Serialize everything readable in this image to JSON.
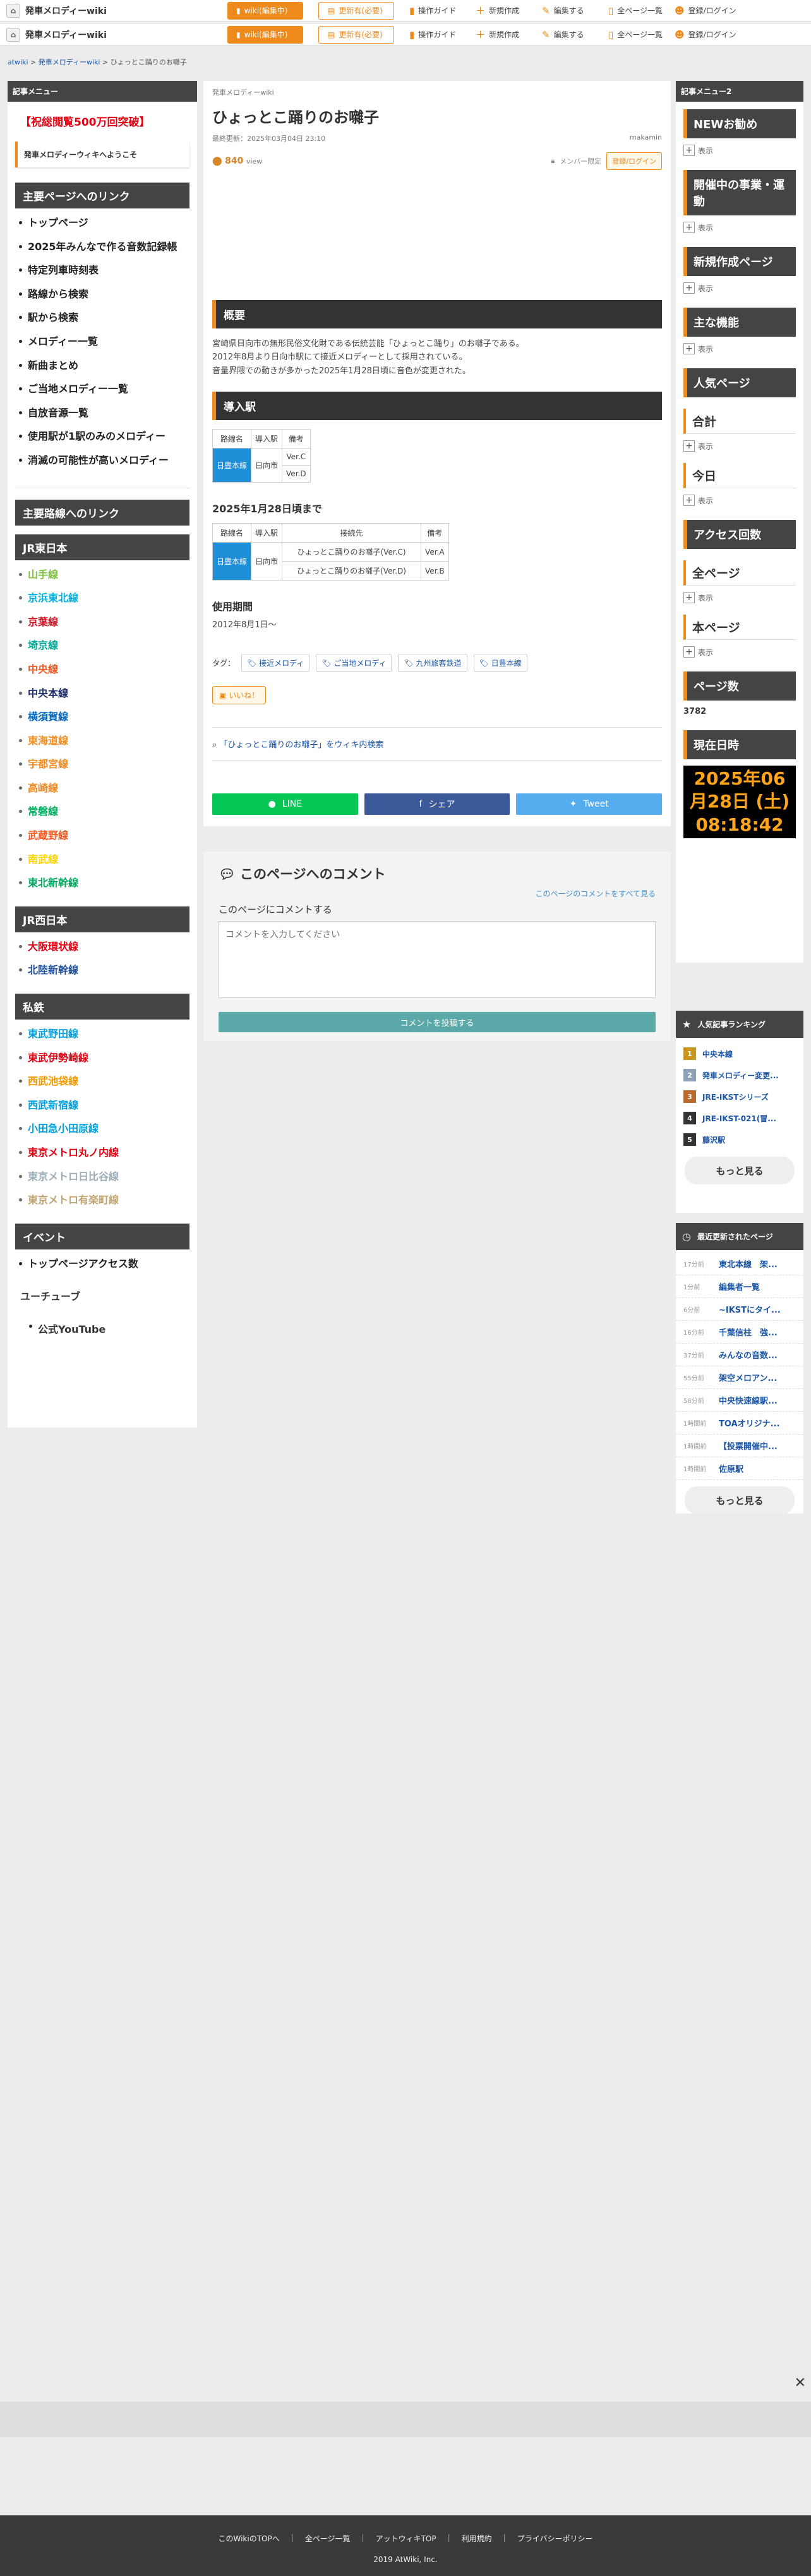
{
  "header": {
    "site_name": "発車メロディーwiki",
    "wiki_edit": "wiki(編集中)",
    "updated": "更新有(必要)",
    "links": [
      "操作ガイド",
      "新規作成",
      "編集する",
      "全ページ一覧",
      "登録/ログイン"
    ]
  },
  "breadcrumb": [
    "atwiki",
    "発車メロディーwiki",
    "ひょっとこ踊りのお囃子"
  ],
  "left": {
    "menu_title": "記事メニュー",
    "pv_text": "【祝総閲覧500万回突破】",
    "welcome": "発車メロディーウィキへようこそ",
    "main_links_head": "主要ページへのリンク",
    "main_links": [
      "トップページ",
      "2025年みんなで作る音数記録帳",
      "特定列車時刻表",
      "路線から検索",
      "駅から検索",
      "メロディー一覧",
      "新曲まとめ",
      "ご当地メロディー一覧",
      "自放音源一覧",
      "使用駅が1駅のみのメロディー",
      "消滅の可能性が高いメロディー"
    ],
    "routes_head": "主要路線へのリンク",
    "jr_east_head": "JR東日本",
    "jr_east": [
      {
        "name": "山手線",
        "color": "#80c241"
      },
      {
        "name": "京浜東北線",
        "color": "#00b2e5"
      },
      {
        "name": "京葉線",
        "color": "#d01827"
      },
      {
        "name": "埼京線",
        "color": "#00ac9a"
      },
      {
        "name": "中央線",
        "color": "#f15a22"
      },
      {
        "name": "中央本線",
        "color": "#1a2c6e"
      },
      {
        "name": "横須賀線",
        "color": "#0067c0"
      },
      {
        "name": "東海道線",
        "color": "#f68b1e"
      },
      {
        "name": "宇都宮線",
        "color": "#f68b1e"
      },
      {
        "name": "高崎線",
        "color": "#f68b1e"
      },
      {
        "name": "常磐線",
        "color": "#00b261"
      },
      {
        "name": "武蔵野線",
        "color": "#f15a22"
      },
      {
        "name": "南武線",
        "color": "#ffd400"
      },
      {
        "name": "東北新幹線",
        "color": "#00a862"
      }
    ],
    "jr_west_head": "JR西日本",
    "jr_west": [
      {
        "name": "大阪環状線",
        "color": "#e60012"
      },
      {
        "name": "北陸新幹線",
        "color": "#1d4f9c"
      }
    ],
    "private_head": "私鉄",
    "private": [
      {
        "name": "東武野田線",
        "color": "#00a0de"
      },
      {
        "name": "東武伊勢崎線",
        "color": "#e60012"
      },
      {
        "name": "西武池袋線",
        "color": "#f39800"
      },
      {
        "name": "西武新宿線",
        "color": "#00a0de"
      },
      {
        "name": "小田急小田原線",
        "color": "#00a0de"
      },
      {
        "name": "東京メトロ丸ノ内線",
        "color": "#e60012"
      },
      {
        "name": "東京メトロ日比谷線",
        "color": "#9caeb7"
      },
      {
        "name": "東京メトロ有楽町線",
        "color": "#c1a470"
      }
    ],
    "event_head": "イベント",
    "event_links": [
      "トップページアクセス数"
    ],
    "youtube_head": "ユーチューブ",
    "youtube_link": "公式YouTube"
  },
  "main": {
    "site_small": "発車メロディーwiki",
    "title": "ひょっとこ踊りのお囃子",
    "last_updated": "最終更新：2025年03月04日 23:10",
    "author": "makamin",
    "views": "840",
    "views_label": "view",
    "member_limit": "メンバー限定",
    "login": "登録/ログイン",
    "overview_head": "概要",
    "overview_lines": [
      "宮崎県日向市の無形民俗文化財である伝統芸能「ひょっとこ踊り」のお囃子である。",
      "2012年8月より日向市駅にて接近メロディーとして採用されている。",
      "音量界隈での動きが多かった2025年1月28日頃に音色が変更された。"
    ],
    "station_head": "導入駅",
    "table1_headers": [
      "路線名",
      "導入駅",
      "備考"
    ],
    "table1": {
      "line": "日豊本線",
      "station": "日向市",
      "notes": [
        "Ver.C",
        "Ver.D"
      ]
    },
    "until_head": "2025年1月28日頃まで",
    "table2_headers": [
      "路線名",
      "導入駅",
      "接続先",
      "備考"
    ],
    "table2": {
      "line": "日豊本線",
      "station": "日向市",
      "rows": [
        [
          "ひょっとこ踊りのお囃子(Ver.C)",
          "Ver.A"
        ],
        [
          "ひょっとこ踊りのお囃子(Ver.D)",
          "Ver.B"
        ]
      ]
    },
    "period_head": "使用期間",
    "period": "2012年8月1日〜",
    "tags_label": "タグ：",
    "tags": [
      "接近メロディ",
      "ご当地メロディ",
      "九州旅客鉄道",
      "日豊本線"
    ],
    "iine": "いいね！",
    "search_link": "「ひょっとこ踊りのお囃子」をウィキ内検索",
    "share": [
      "LINE",
      "シェア",
      "Tweet"
    ]
  },
  "comments": {
    "title": "このページへのコメント",
    "view_all": "このページのコメントをすべて見る",
    "label": "このページにコメントする",
    "placeholder": "コメントを入力してください",
    "post": "コメントを投稿する"
  },
  "right": {
    "menu2": "記事メニュー2",
    "new_rec": "NEWお勧め",
    "show": "表示",
    "events": "開催中の事業・運動",
    "new_pages": "新規作成ページ",
    "features": "主な機能",
    "popular": "人気ページ",
    "total": "合計",
    "today": "今日",
    "access": "アクセス回数",
    "all_pages": "全ページ",
    "this_page": "本ページ",
    "page_count_head": "ページ数",
    "page_count": "3782",
    "datetime_head": "現在日時",
    "clock_date1": "2025年06",
    "clock_date2": "月28日 (土)",
    "clock_time": "08:18:42",
    "ranking_head": "人気記事ランキング",
    "ranking": [
      {
        "n": "1",
        "title": "中央本線",
        "color": "#c8961e"
      },
      {
        "n": "2",
        "title": "発車メロディー変更...",
        "color": "#8da2b7"
      },
      {
        "n": "3",
        "title": "JRE-IKSTシリーズ",
        "color": "#b96a2e"
      },
      {
        "n": "4",
        "title": "JRE-IKST-021(冒...",
        "color": "#333333"
      },
      {
        "n": "5",
        "title": "藤沢駅",
        "color": "#333333"
      }
    ],
    "more": "もっと見る",
    "recent_head": "最近更新されたページ",
    "recent": [
      {
        "t": "17分前",
        "title": "東北本線　架..."
      },
      {
        "t": "1分前",
        "title": "編集者一覧"
      },
      {
        "t": "6分前",
        "title": "~IKSTにタイ..."
      },
      {
        "t": "16分前",
        "title": "千葉信柱　強..."
      },
      {
        "t": "37分前",
        "title": "みんなの音数..."
      },
      {
        "t": "55分前",
        "title": "架空メロアン..."
      },
      {
        "t": "58分前",
        "title": "中央快速線駅..."
      },
      {
        "t": "1時間前",
        "title": "TOAオリジナ..."
      },
      {
        "t": "1時間前",
        "title": "【投票開催中..."
      },
      {
        "t": "1時間前",
        "title": "佐原駅"
      }
    ]
  },
  "footer": {
    "links": [
      "このWikiのTOPへ",
      "全ページ一覧",
      "アットウィキTOP",
      "利用規約",
      "プライバシーポリシー"
    ],
    "copyright": "2019 AtWiki, Inc."
  }
}
